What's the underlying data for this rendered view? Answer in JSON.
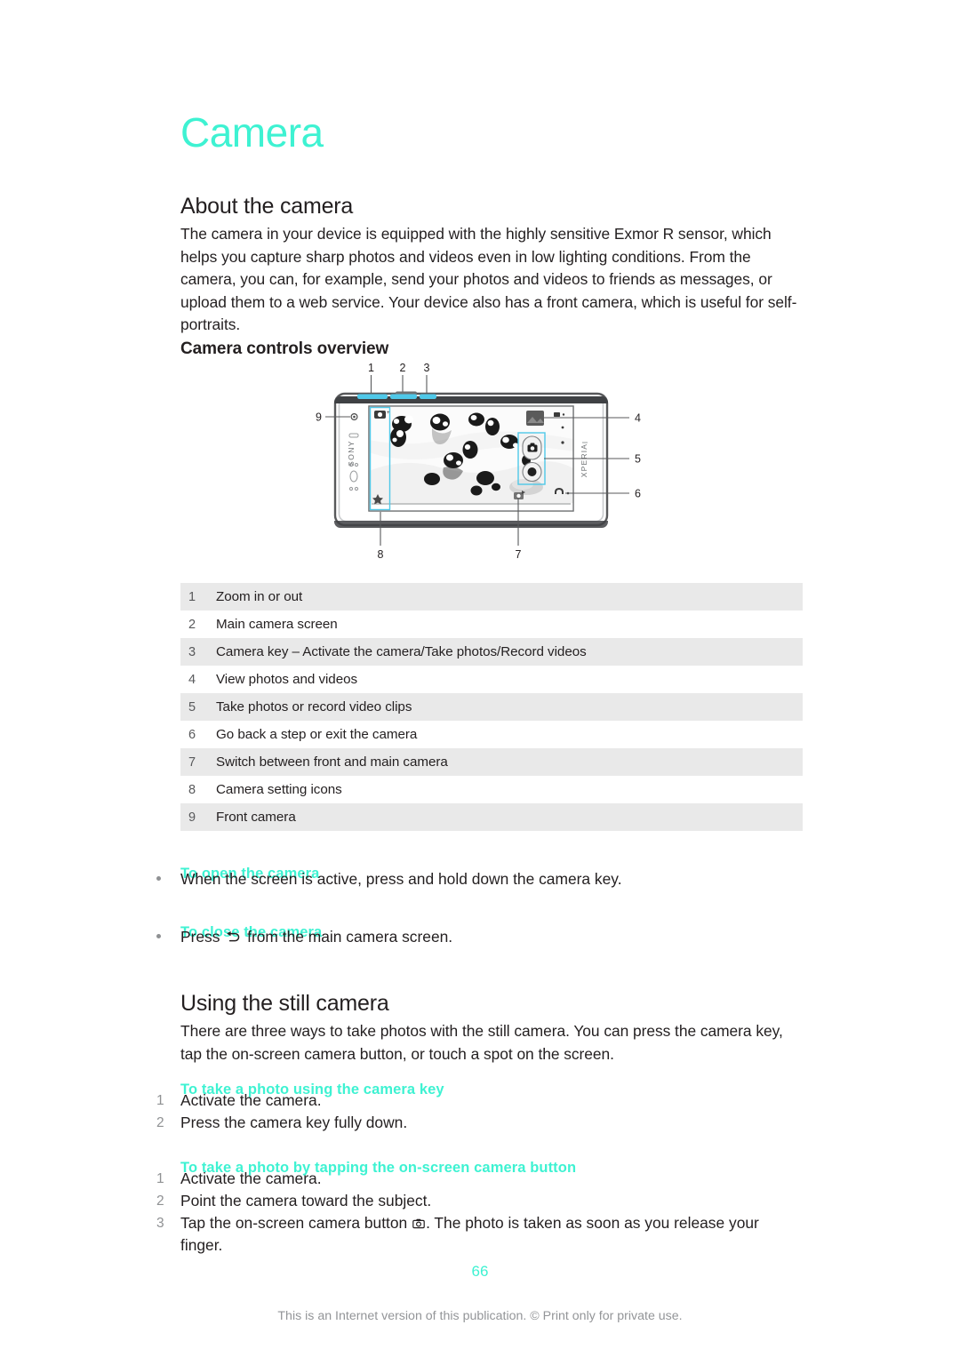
{
  "document": {
    "chapter_title": "Camera",
    "page_number": "66",
    "footer_note": "This is an Internet version of this publication. © Print only for private use.",
    "accent_color": "#3ef2d2",
    "row_shade_color": "#e9e9e9"
  },
  "about": {
    "heading": "About the camera",
    "paragraph": "The camera in your device is equipped with the highly sensitive Exmor R sensor, which helps you capture sharp photos and videos even in low lighting conditions. From the camera, you can, for example, send your photos and videos to friends as messages, or upload them to a web service. Your device also has a front camera, which is useful for self-portraits."
  },
  "controls_overview": {
    "heading": "Camera controls overview",
    "diagram": {
      "device_brand_left": "SONY",
      "device_brand_right": "XPERIA",
      "callout_labels": [
        "1",
        "2",
        "3",
        "4",
        "5",
        "6",
        "7",
        "8",
        "9"
      ],
      "screen_subject": "black and white photo of penguins in snow",
      "highlight_color": "#4fc8e8"
    },
    "table": {
      "rows": [
        {
          "num": "1",
          "text": "Zoom in or out"
        },
        {
          "num": "2",
          "text": "Main camera screen"
        },
        {
          "num": "3",
          "text": "Camera key – Activate the camera/Take photos/Record videos"
        },
        {
          "num": "4",
          "text": "View photos and videos"
        },
        {
          "num": "5",
          "text": "Take photos or record video clips"
        },
        {
          "num": "6",
          "text": "Go back a step or exit the camera"
        },
        {
          "num": "7",
          "text": "Switch between front and main camera"
        },
        {
          "num": "8",
          "text": "Camera setting icons"
        },
        {
          "num": "9",
          "text": "Front camera"
        }
      ]
    }
  },
  "to_open_the_camera": {
    "heading": "To open the camera",
    "bullet": "When the screen is active, press and hold down the camera key."
  },
  "to_close_the_camera": {
    "heading": "To close the camera",
    "bullet_before_icon": "Press",
    "bullet_icon": "back-arrow-icon",
    "bullet_after_icon": "from the main camera screen."
  },
  "using_still_camera": {
    "heading": "Using the still camera",
    "paragraph": "There are three ways to take photos with the still camera. You can press the camera key, tap the on-screen camera button, or touch a spot on the screen."
  },
  "take_photo_camera_key": {
    "heading": "To take a photo using the camera key",
    "steps": [
      {
        "num": "1",
        "text": "Activate the camera."
      },
      {
        "num": "2",
        "text": "Press the camera key fully down."
      }
    ]
  },
  "take_photo_onscreen_button": {
    "heading": "To take a photo by tapping the on-screen camera button",
    "steps": [
      {
        "num": "1",
        "text": "Activate the camera."
      },
      {
        "num": "2",
        "text": "Point the camera toward the subject."
      }
    ],
    "step3_before_icon": "Tap the on-screen camera button",
    "step3_icon": "camera-button-icon",
    "step3_after_icon": ". The photo is taken as soon as you release your finger."
  }
}
